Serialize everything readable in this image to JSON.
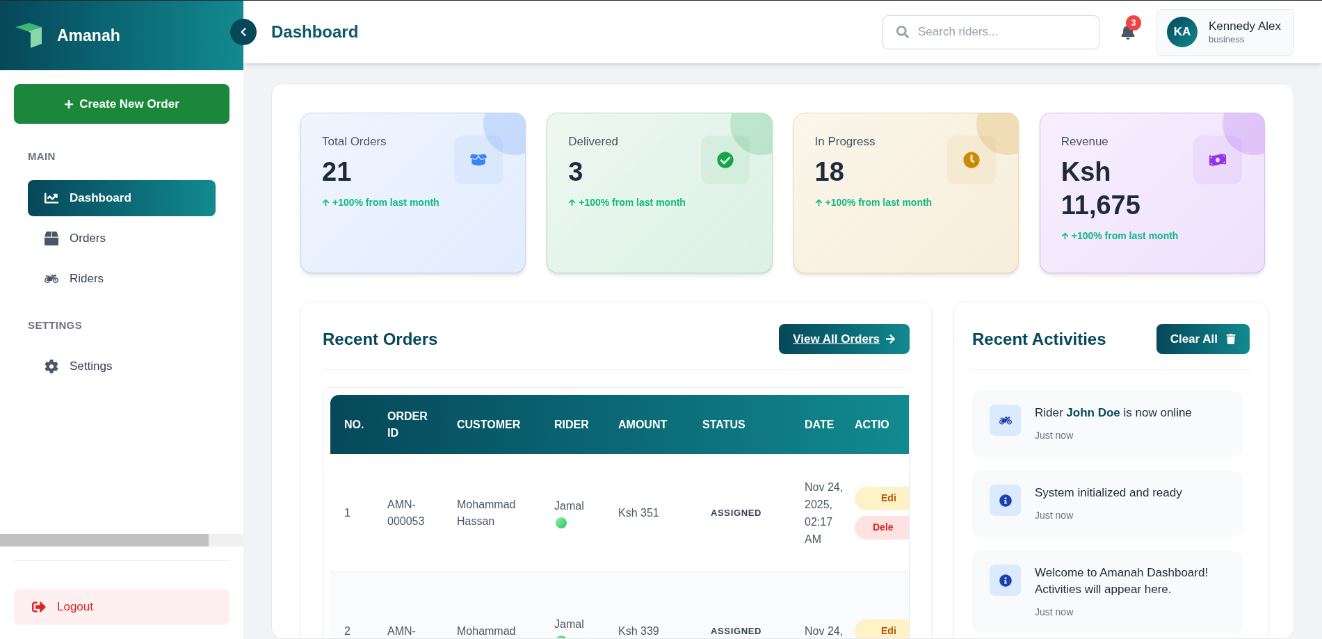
{
  "sidebar": {
    "brand": "Amanah",
    "create_button": "Create New Order",
    "sections": [
      {
        "label": "MAIN",
        "items": [
          {
            "label": "Dashboard",
            "kind": "chart",
            "selected": true
          },
          {
            "label": "Orders",
            "kind": "box",
            "selected": false
          },
          {
            "label": "Riders",
            "kind": "rider",
            "selected": false
          }
        ]
      },
      {
        "label": "SETTINGS",
        "items": [
          {
            "label": "Settings",
            "kind": "gear",
            "selected": false
          }
        ]
      }
    ],
    "logout": "Logout"
  },
  "header": {
    "title": "Dashboard",
    "search": {
      "placeholder": "Search riders..."
    },
    "notifications": "3",
    "user": {
      "initials": "KA",
      "name": "Kennedy Alex",
      "role": "business"
    }
  },
  "stats": [
    {
      "label": "Total Orders",
      "value": "21",
      "trend": "+100% from last month",
      "kind": "box",
      "color": "#3b82f6"
    },
    {
      "label": "Delivered",
      "value": "3",
      "trend": "+100% from last month",
      "kind": "check",
      "color": "#16a34a"
    },
    {
      "label": "In Progress",
      "value": "18",
      "trend": "+100% from last month",
      "kind": "clock",
      "color": "#ca8a04"
    },
    {
      "label": "Revenue",
      "value": "Ksh 11,675",
      "trend": "+100% from last month",
      "kind": "money",
      "color": "#9333ea"
    }
  ],
  "recent_orders": {
    "title": "Recent Orders",
    "button": "View All Orders",
    "columns": [
      "NO.",
      "ORDER ID",
      "CUSTOMER",
      "RIDER",
      "AMOUNT",
      "STATUS",
      "DATE",
      "ACTIO"
    ],
    "rows": [
      {
        "no": "1",
        "order_id": "AMN-000053",
        "customer": "Mohammad Hassan",
        "rider": "Jamal",
        "online": true,
        "amount": "Ksh 351",
        "status": "ASSIGNED",
        "date": "Nov 24, 2025, 02:17 AM",
        "actions": [
          "Edi",
          "Dele"
        ]
      },
      {
        "no": "2",
        "order_id": "AMN-",
        "customer": "Mohammad",
        "rider": "Jamal",
        "online": true,
        "amount": "Ksh 339",
        "status": "ASSIGNED",
        "date": "Nov 24,",
        "actions": [
          "Edi"
        ]
      }
    ]
  },
  "recent_activities": {
    "title": "Recent Activities",
    "button": "Clear All",
    "items": [
      {
        "kind": "rider",
        "text": "Rider **John Doe** is now online",
        "time": "Just now"
      },
      {
        "kind": "info",
        "text": "System initialized and ready",
        "time": "Just now"
      },
      {
        "kind": "info",
        "text": "Welcome to Amanah Dashboard! Activities will appear here.",
        "time": "Just now"
      }
    ]
  }
}
